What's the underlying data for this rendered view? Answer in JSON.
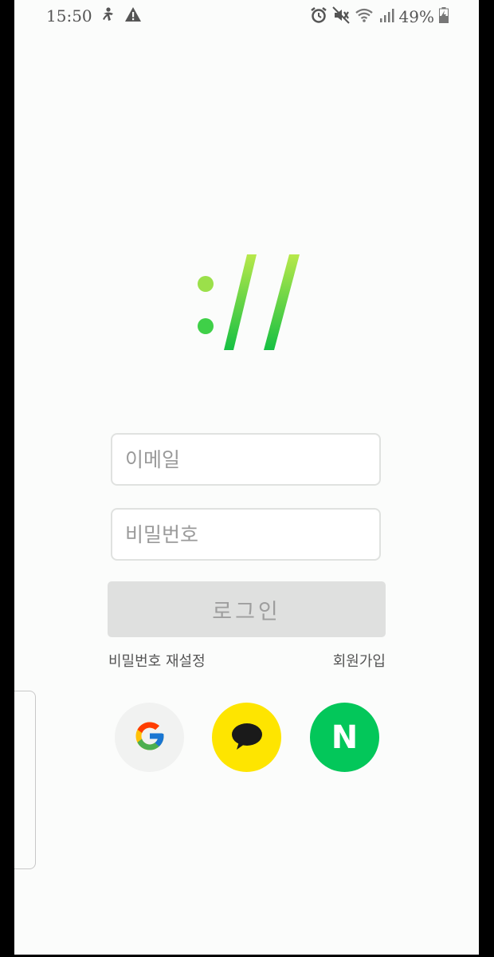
{
  "status_bar": {
    "time": "15:50",
    "battery": "49%",
    "icons_left": [
      "accessibility-icon",
      "warning-icon"
    ],
    "icons_right": [
      "alarm-icon",
      "mute-icon",
      "wifi-icon",
      "signal-icon",
      "battery-icon"
    ]
  },
  "logo": {
    "icon": "colon-double-slash-logo",
    "color_top": "#b7e84a",
    "color_bottom": "#16c043"
  },
  "form": {
    "email_placeholder": "이메일",
    "password_placeholder": "비밀번호",
    "login_label": "로그인"
  },
  "links": {
    "reset_password": "비밀번호 재설정",
    "signup": "회원가입"
  },
  "social": [
    {
      "name": "google",
      "icon": "google-icon",
      "bg": "#f1f2f1"
    },
    {
      "name": "kakao",
      "icon": "kakao-talk-icon",
      "bg": "#fee500"
    },
    {
      "name": "naver",
      "icon": "naver-icon",
      "bg": "#03c75a",
      "letter": "N"
    }
  ]
}
